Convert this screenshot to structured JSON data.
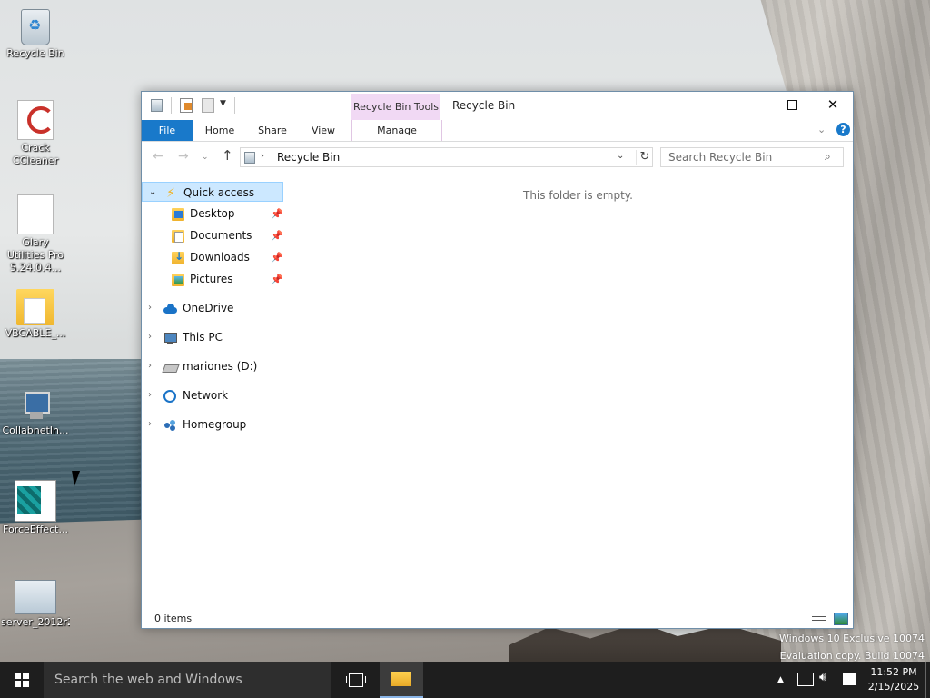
{
  "desktop": {
    "icons": [
      {
        "label": "Recycle Bin",
        "icon": "recycle-bin-icon"
      },
      {
        "label": "Crack CCleaner",
        "icon": "ccleaner-icon"
      },
      {
        "label": "Glary Utilities Pro 5.24.0.4...",
        "icon": "document-icon"
      },
      {
        "label": "VBCABLE_...",
        "icon": "folder-icon"
      },
      {
        "label": "CollabnetIn...",
        "icon": "computer-icon"
      },
      {
        "label": "ForceEffect...",
        "icon": "registry-icon"
      },
      {
        "label": "server_2012r2",
        "icon": "image-icon"
      }
    ]
  },
  "window": {
    "title": "Recycle Bin",
    "context_tab": "Recycle Bin Tools",
    "ribbon_tabs": {
      "file": "File",
      "home": "Home",
      "share": "Share",
      "view": "View",
      "manage": "Manage"
    },
    "help_label": "?",
    "address": {
      "path": "Recycle Bin"
    },
    "search": {
      "placeholder": "Search Recycle Bin"
    },
    "nav_pane": {
      "quick_access": "Quick access",
      "pinned": [
        {
          "label": "Desktop"
        },
        {
          "label": "Documents"
        },
        {
          "label": "Downloads"
        },
        {
          "label": "Pictures"
        }
      ],
      "locations": [
        {
          "label": "OneDrive"
        },
        {
          "label": "This PC"
        },
        {
          "label": "mariones (D:)"
        },
        {
          "label": "Network"
        },
        {
          "label": "Homegroup"
        }
      ]
    },
    "content": {
      "empty_message": "This folder is empty."
    },
    "status": {
      "item_count": "0 items"
    }
  },
  "watermark": {
    "line1": "Windows 10 Exclusive 10074",
    "line2": "Evaluation copy. Build 10074"
  },
  "taskbar": {
    "search_placeholder": "Search the web and Windows",
    "time": "11:52 PM",
    "date": "2/15/2025"
  },
  "colors": {
    "accent": "#1979ca",
    "context_tab": "#f1d9f4",
    "selection": "#cce8ff",
    "taskbar": "#1e1e1e"
  }
}
